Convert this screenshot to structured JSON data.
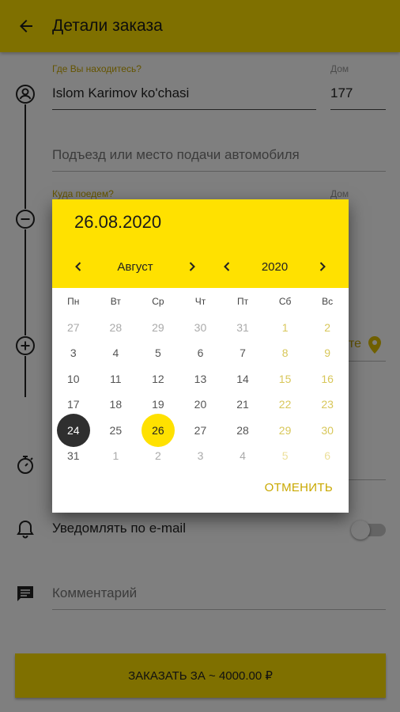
{
  "appbar": {
    "title": "Детали заказа",
    "back_icon": "arrow-left-icon"
  },
  "form": {
    "from_label": "Где Вы находитесь?",
    "from_value": "Islom Karimov ko'chasi",
    "from_house_label": "Дом",
    "from_house_value": "177",
    "entrance_placeholder": "Подъезд или место подачи автомобиля",
    "to_label": "Куда поедем?",
    "to_house_label": "Дом",
    "map_partial": "те",
    "notify_label": "Уведомлять по e-mail",
    "comment_placeholder": "Комментарий",
    "order_button": "ЗАКАЗАТЬ ЗА ~ 4000.00 ₽",
    "notify_enabled": false
  },
  "datepicker": {
    "selected_date": "26.08.2020",
    "month": "Август",
    "year": "2020",
    "weekdays": [
      "Пн",
      "Вт",
      "Ср",
      "Чт",
      "Пт",
      "Сб",
      "Вс"
    ],
    "weeks": [
      [
        "27",
        "28",
        "29",
        "30",
        "31",
        "1",
        "2"
      ],
      [
        "3",
        "4",
        "5",
        "6",
        "7",
        "8",
        "9"
      ],
      [
        "10",
        "11",
        "12",
        "13",
        "14",
        "15",
        "16"
      ],
      [
        "17",
        "18",
        "19",
        "20",
        "21",
        "22",
        "23"
      ],
      [
        "24",
        "25",
        "26",
        "27",
        "28",
        "29",
        "30"
      ],
      [
        "31",
        "1",
        "2",
        "3",
        "4",
        "5",
        "6"
      ]
    ],
    "cancel_label": "ОТМЕНИТЬ"
  },
  "colors": {
    "accent": "#ffe100",
    "accent_text": "#c9a800",
    "today_circle": "#2f2f2f"
  }
}
